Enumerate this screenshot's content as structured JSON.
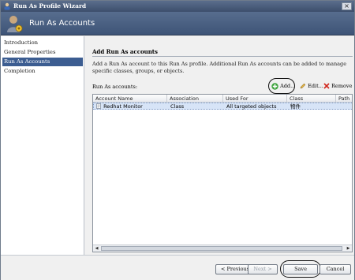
{
  "window": {
    "title": "Run As Profile Wizard"
  },
  "header": {
    "title": "Run As Accounts"
  },
  "sidebar": {
    "items": [
      {
        "label": "Introduction",
        "active": false
      },
      {
        "label": "General Properties",
        "active": false
      },
      {
        "label": "Run As Accounts",
        "active": true
      },
      {
        "label": "Completion",
        "active": false
      }
    ]
  },
  "content": {
    "section_title": "Add Run As accounts",
    "description": "Add a Run As account to this Run As profile.  Additional Run As accounts can be added to manage specific classes, groups, or objects.",
    "accounts_label": "Run As accounts:",
    "toolbar": {
      "add": "Add...",
      "edit": "Edit...",
      "remove": "Remove"
    },
    "table": {
      "columns": [
        "Account Name",
        "Association",
        "Used For",
        "Class",
        "Path"
      ],
      "rows": [
        {
          "account_name": "Redhat Monitor",
          "association": "Class",
          "used_for": "All targeted objects",
          "class": "物件",
          "path": ""
        }
      ]
    }
  },
  "footer": {
    "previous": "< Previous",
    "next": "Next >",
    "save": "Save",
    "cancel": "Cancel"
  },
  "colors": {
    "active_nav": "#3c5d91",
    "header_bg": "#4a5f82",
    "add_icon": "#3aa23a",
    "remove_icon": "#d0261c"
  }
}
